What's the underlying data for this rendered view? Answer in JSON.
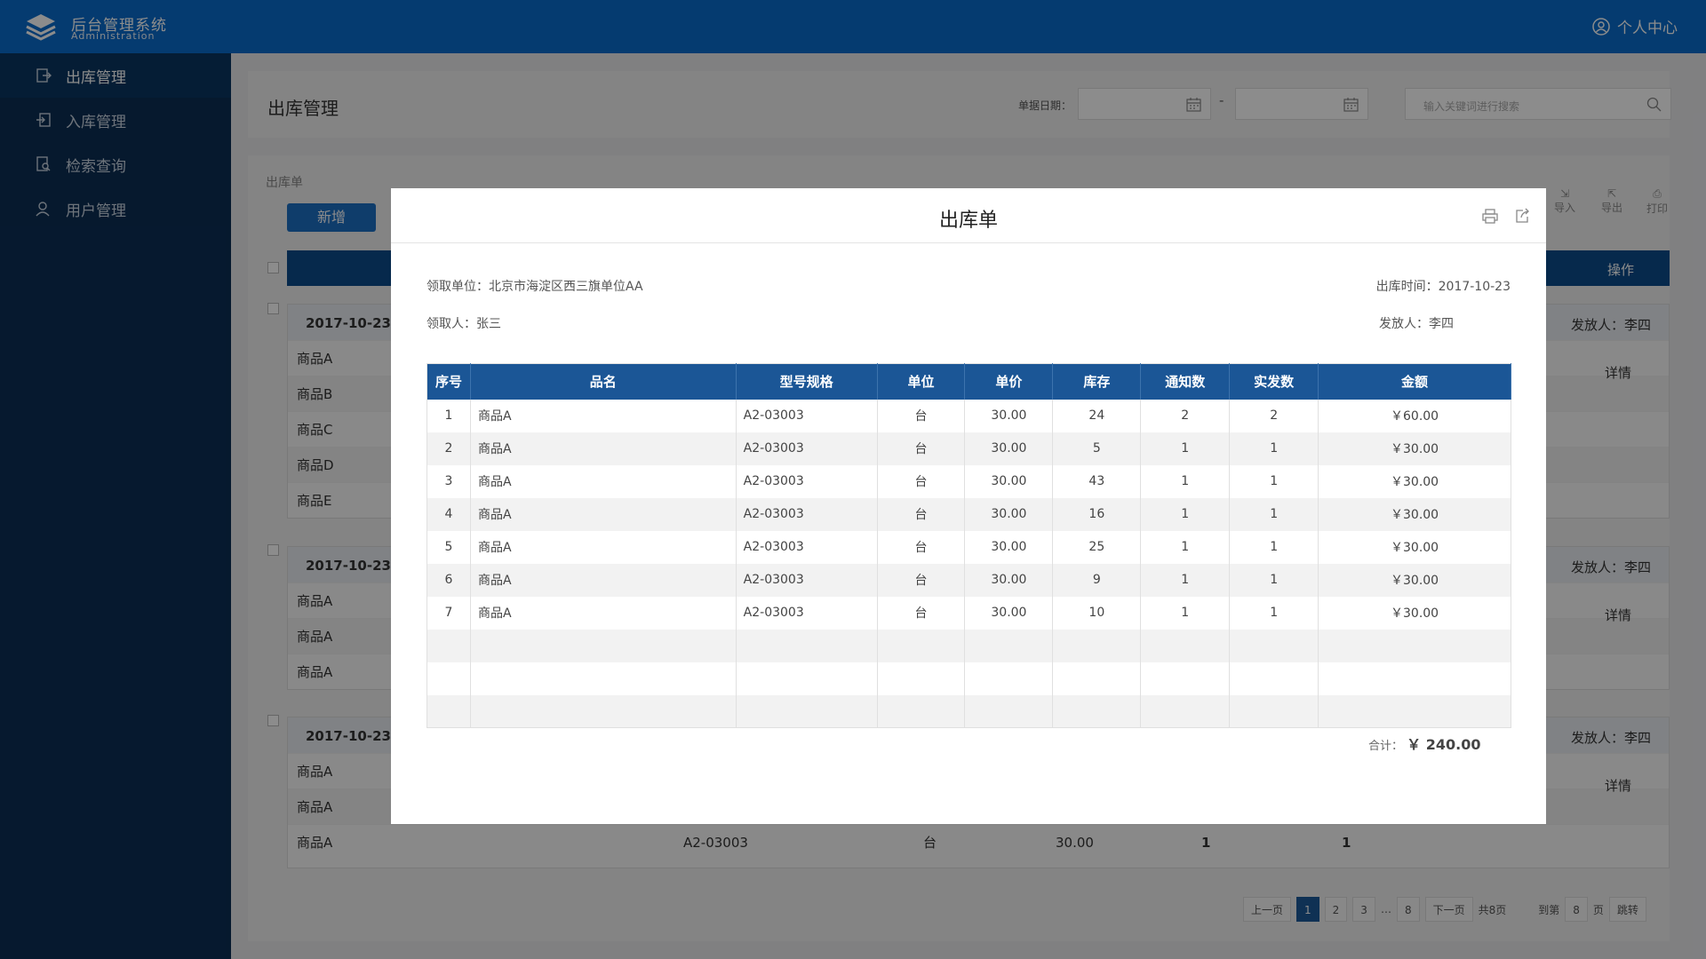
{
  "header": {
    "brand_title": "后台管理系统",
    "brand_subtitle": "Administration",
    "user_center": "个人中心"
  },
  "sidebar": {
    "items": [
      {
        "label": "出库管理",
        "icon": "export-icon"
      },
      {
        "label": "入库管理",
        "icon": "import-icon"
      },
      {
        "label": "检索查询",
        "icon": "search-doc-icon"
      },
      {
        "label": "用户管理",
        "icon": "user-icon"
      }
    ]
  },
  "filters": {
    "page_title": "出库管理",
    "date_label": "单据日期：",
    "dash": "-",
    "search_placeholder": "输入关键词进行搜索"
  },
  "list": {
    "crumb": "出库单",
    "add_button": "新增",
    "import": "导入",
    "export": "导出",
    "print": "打印",
    "operation": "操作",
    "groups": [
      {
        "date": "2017-10-23",
        "issuer": "发放人：李四",
        "detail": "详情",
        "rows": [
          "商品A",
          "商品B",
          "商品C",
          "商品D",
          "商品E"
        ]
      },
      {
        "date": "2017-10-23",
        "issuer": "发放人：李四",
        "detail": "详情",
        "rows": [
          "商品A",
          "商品A",
          "商品A"
        ]
      },
      {
        "date": "2017-10-23",
        "issuer": "发放人：李四",
        "detail": "详情",
        "rows": [
          "商品A",
          "商品A",
          "商品A"
        ]
      }
    ],
    "last_row": {
      "model": "A2-03003",
      "unit": "台",
      "price": "30.00",
      "notice": "1",
      "actual": "1"
    }
  },
  "pager": {
    "prev": "上一页",
    "pages": [
      "1",
      "2",
      "3",
      "…",
      "8"
    ],
    "next": "下一页",
    "total": "共8页",
    "goto": "到第",
    "goto_page": "8",
    "page_suffix": "页",
    "jump": "跳转"
  },
  "modal": {
    "title": "出库单",
    "receiver_unit": "领取单位：北京市海淀区西三旗单位AA",
    "out_time": "出库时间：2017-10-23",
    "receiver": "领取人：张三",
    "issuer": "发放人：李四",
    "columns": [
      "序号",
      "品名",
      "型号规格",
      "单位",
      "单价",
      "库存",
      "通知数",
      "实发数",
      "金额"
    ],
    "rows": [
      [
        "1",
        "商品A",
        "A2-03003",
        "台",
        "30.00",
        "24",
        "2",
        "2",
        "￥60.00"
      ],
      [
        "2",
        "商品A",
        "A2-03003",
        "台",
        "30.00",
        "5",
        "1",
        "1",
        "￥30.00"
      ],
      [
        "3",
        "商品A",
        "A2-03003",
        "台",
        "30.00",
        "43",
        "1",
        "1",
        "￥30.00"
      ],
      [
        "4",
        "商品A",
        "A2-03003",
        "台",
        "30.00",
        "16",
        "1",
        "1",
        "￥30.00"
      ],
      [
        "5",
        "商品A",
        "A2-03003",
        "台",
        "30.00",
        "25",
        "1",
        "1",
        "￥30.00"
      ],
      [
        "6",
        "商品A",
        "A2-03003",
        "台",
        "30.00",
        "9",
        "1",
        "1",
        "￥30.00"
      ],
      [
        "7",
        "商品A",
        "A2-03003",
        "台",
        "30.00",
        "10",
        "1",
        "1",
        "￥30.00"
      ]
    ],
    "empty_rows": 3,
    "total_label": "合计：",
    "total_value": "￥ 240.00"
  }
}
